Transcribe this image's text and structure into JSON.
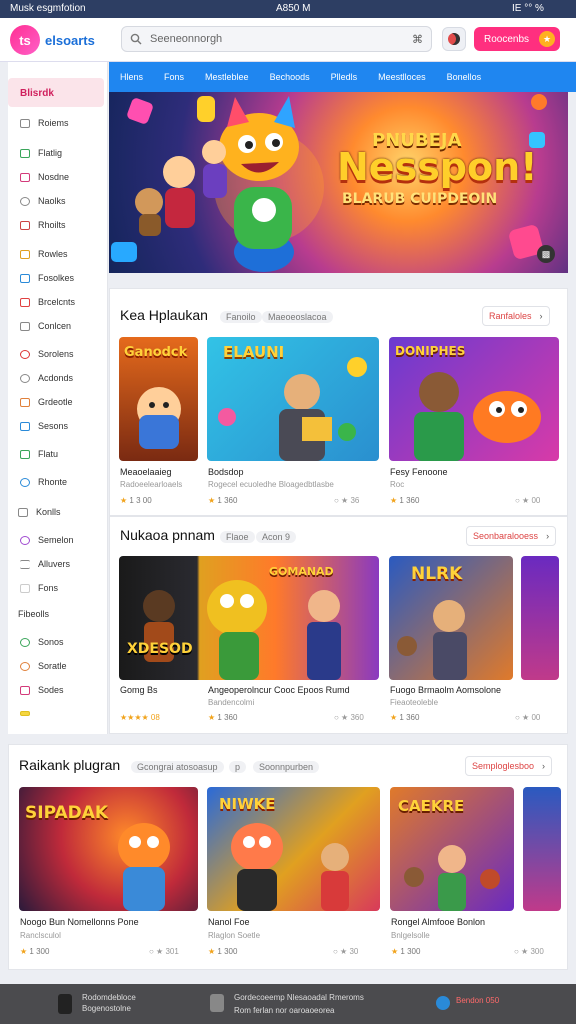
{
  "status": {
    "left": "Musk esgmfotion",
    "center": "A850 M",
    "right": "IE °° %"
  },
  "header": {
    "logo_text": "elsoarts",
    "search_placeholder": "Seeneonnorgh",
    "search_right": "⌘",
    "signin_label": "Roocenbs",
    "signin_badge": "★"
  },
  "tabs": [
    "Hlens",
    "Fons",
    "Mestleblee",
    "Bechoods",
    "Plledls",
    "Meestlloces",
    "Bonellos"
  ],
  "sidebar": {
    "active": "Blisrdk",
    "items": [
      "Roiems",
      "Flatlig",
      "Nosdne",
      "Naolks",
      "Rhoilts",
      "Rowles",
      "Fosolkes",
      "Brcelcnts",
      "Conlcen",
      "Sorolens",
      "Acdonds",
      "Grdeotle",
      "Sesons",
      "Flatu",
      "Rhonte",
      "Konlls",
      "Semelon",
      "Alluvers",
      "Fons",
      "Fibeolls",
      "Sonos",
      "Soratle",
      "Sodes",
      ""
    ]
  },
  "banner": {
    "line1": "PNUBEJA",
    "line2": "Nesspon!",
    "line3": "BLARUB CUIPDEOIN"
  },
  "sections": [
    {
      "title": "Kea Hplaukan",
      "chips": [
        "Fanoilo",
        "Maeoeoslacoa"
      ],
      "more": "Ranfaloles",
      "cards": [
        {
          "art": "Ganodck",
          "title": "Meaoelaaieg",
          "sub": "Radoeelearloaels",
          "rating": "1 3 00",
          "meta": ""
        },
        {
          "art": "ELAUNI",
          "title": "Bodsdop",
          "sub": "Rogecel ecuoledhe Bloagedbtlasbe",
          "rating": "1 360",
          "meta": "○  ★ 36"
        },
        {
          "art": "DONIPHES",
          "title": "Fesy Fenoone",
          "sub": "Roc",
          "rating": "1 360",
          "meta": "○  ★ 00"
        }
      ]
    },
    {
      "title": "Nukaoa pnnam",
      "chips": [
        "Flaoe",
        "Acon 9"
      ],
      "more": "Seonbaralooess",
      "cards": [
        {
          "art": "XDESOD",
          "title": "Gomg Bs",
          "sub": "",
          "rating": "★★★★ 08",
          "meta": ""
        },
        {
          "art": "GOMANAD",
          "title": "Angeoperolncur Cooc Epoos Rumd",
          "sub": "Bandencolmi",
          "rating": "1 360",
          "meta": "○  ★ 360"
        },
        {
          "art": "NLRK",
          "title": "Fuogo Brmaolm Aomsolone",
          "sub": "Fieaoteoleble",
          "rating": "1 360",
          "meta": "○  ★ 00 "
        }
      ]
    },
    {
      "title": "Raikank plugran",
      "chips": [
        "Gcongrai atosoasup",
        "p",
        "Soonnpurben"
      ],
      "more": "Semploglesboo",
      "cards": [
        {
          "art": "SIPADAK",
          "title": "Noogo Bun Nomellonns Pone",
          "sub": "Ranclsculol",
          "rating": "1 300",
          "meta": "○  ★ 301"
        },
        {
          "art": "NIWKE",
          "title": "Nanol Foe",
          "sub": "Rlaglon Soetle",
          "rating": "1 300",
          "meta": "○  ★ 30"
        },
        {
          "art": "CAEKRE",
          "title": "Rongel Almfooe Bonlon",
          "sub": "Bnlgelsolle",
          "rating": "1 300",
          "meta": "○  ★ 300"
        }
      ]
    }
  ],
  "bottom": {
    "left_line1": "Rodomdebloce",
    "left_line2": "Bogenostolne",
    "mid_line1": "Gordecoeemp Nlesaoadal Rmeroms",
    "mid_line2": "Rom ferlan nor oaroaoeorea",
    "right_label": "Bendon 050"
  }
}
